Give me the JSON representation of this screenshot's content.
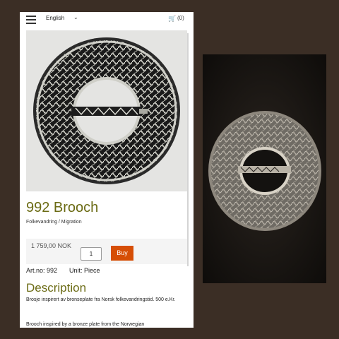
{
  "header": {
    "language": "English",
    "cart_count": "(0)"
  },
  "product": {
    "title": "992 Brooch",
    "subtitle": "Folkevandring / Migration",
    "price": "1 759,00 NOK",
    "quantity": "1",
    "buy_label": "Buy",
    "art_no": "Art.no: 992",
    "unit": "Unit: Piece"
  },
  "description": {
    "heading": "Description",
    "text_no": "Brosje inspirert av bronseplate fra Norsk folkevandringstid. 500 e.Kr.",
    "text_en": "Brooch inspired by a bronze plate from the Norwegian"
  },
  "colors": {
    "title_olive": "#6b6b14",
    "buy_orange": "#d64e05",
    "frame_brown": "#3b2e25"
  }
}
